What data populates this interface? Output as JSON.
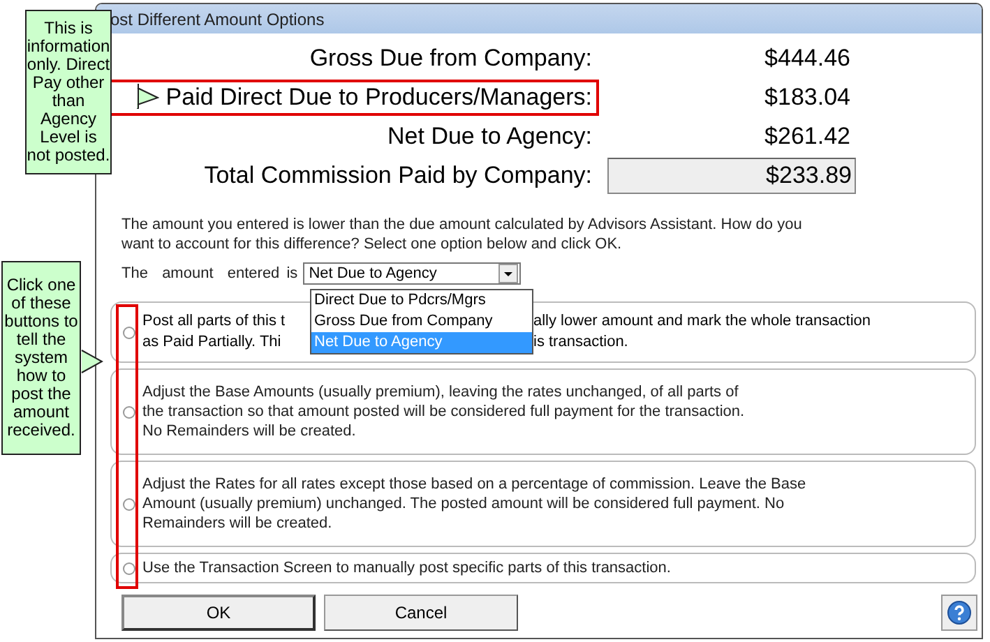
{
  "window": {
    "title": "ost Different Amount Options"
  },
  "summary": [
    {
      "label": "Gross Due from Company:",
      "value": "$444.46",
      "highlighted": false,
      "kind": "text"
    },
    {
      "label": "Paid Direct Due to Producers/Managers:",
      "value": "$183.04",
      "highlighted": true,
      "kind": "text"
    },
    {
      "label": "Net Due to Agency:",
      "value": "$261.42",
      "highlighted": false,
      "kind": "text"
    },
    {
      "label": "Total Commission Paid by Company:",
      "value": "$233.89",
      "highlighted": false,
      "kind": "box"
    }
  ],
  "message": "The amount you entered is lower than the due amount calculated by Advisors Assistant. How do you want to account for this difference? Select one option below and click OK.",
  "amount_select": {
    "label": "The  amount  entered is",
    "value": "Net Due to Agency",
    "options": [
      {
        "label": "Direct Due to Pdcrs/Mgrs",
        "selected": false
      },
      {
        "label": "Gross Due from Company",
        "selected": false
      },
      {
        "label": "Net Due to Agency",
        "selected": true
      }
    ]
  },
  "options": [
    {
      "kind": "split",
      "selected": false,
      "lines": [
        [
          "Post all parts of this t",
          "ally lower amount and mark the whole transaction"
        ],
        [
          "as Paid Partially.  Thi",
          "is transaction."
        ]
      ]
    },
    {
      "kind": "text",
      "selected": false,
      "text": "Adjust the Base Amounts (usually premium), leaving the rates unchanged, of all parts of\nthe transaction so that amount posted will be considered full payment for the transaction.\nNo Remainders will be created."
    },
    {
      "kind": "text",
      "selected": false,
      "text": "Adjust the Rates for all rates except those based on a percentage of commission.  Leave the Base\nAmount (usually premium) unchanged. The posted amount will be considered full payment. No\nRemainders will be created."
    },
    {
      "kind": "text",
      "selected": false,
      "text": "Use the Transaction Screen to manually post specific parts of this transaction."
    }
  ],
  "buttons": [
    "OK",
    "Cancel"
  ],
  "callouts": [
    {
      "text": "This is information only.  Direct Pay other than Agency Level is not posted."
    },
    {
      "text": "Click one of these buttons to tell the system how to post the amount received."
    }
  ]
}
